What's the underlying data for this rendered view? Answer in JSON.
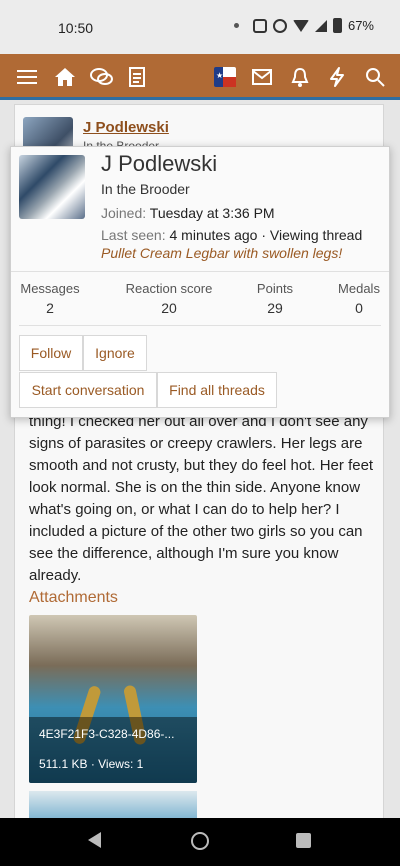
{
  "status_bar": {
    "time": "10:50",
    "battery": "67%"
  },
  "navbar": {
    "icons": [
      "menu-icon",
      "home-icon",
      "forums-icon",
      "pages-icon",
      "flag-icon",
      "inbox-icon",
      "alerts-icon",
      "whats-new-icon",
      "search-icon"
    ]
  },
  "post": {
    "username": "J Podlewski",
    "user_title": "In the Brooder",
    "text": "thing! I checked her out all over and I don't see any signs of parasites or creepy crawlers. Her legs are smooth and not crusty, but they do feel hot. Her feet look normal. She is on the thin side. Anyone know what's going on, or what I can do to help her? I included a picture of the other two girls so you can see the difference, although I'm sure you know already.",
    "attachments_heading": "Attachments",
    "attachment": {
      "name": "4E3F21F3-C328-4D86-...",
      "meta": "511.1 KB · Views: 1"
    }
  },
  "popup": {
    "name": "J Podlewski",
    "title": "In the Brooder",
    "joined_label": "Joined:",
    "joined_value": "Tuesday at 3:36 PM",
    "last_seen_label": "Last seen:",
    "last_seen_value": "4 minutes ago · Viewing thread",
    "thread_title": "Pullet Cream Legbar with swollen legs!",
    "stats": [
      {
        "label": "Messages",
        "value": "2"
      },
      {
        "label": "Reaction score",
        "value": "20"
      },
      {
        "label": "Points",
        "value": "29"
      },
      {
        "label": "Medals",
        "value": "0"
      }
    ],
    "buttons": {
      "follow": "Follow",
      "ignore": "Ignore",
      "start_conversation": "Start conversation",
      "find_threads": "Find all threads"
    }
  },
  "colors": {
    "brand": "#b06a35",
    "accent_blue": "#2f6ea1",
    "link": "#9a5a24"
  }
}
